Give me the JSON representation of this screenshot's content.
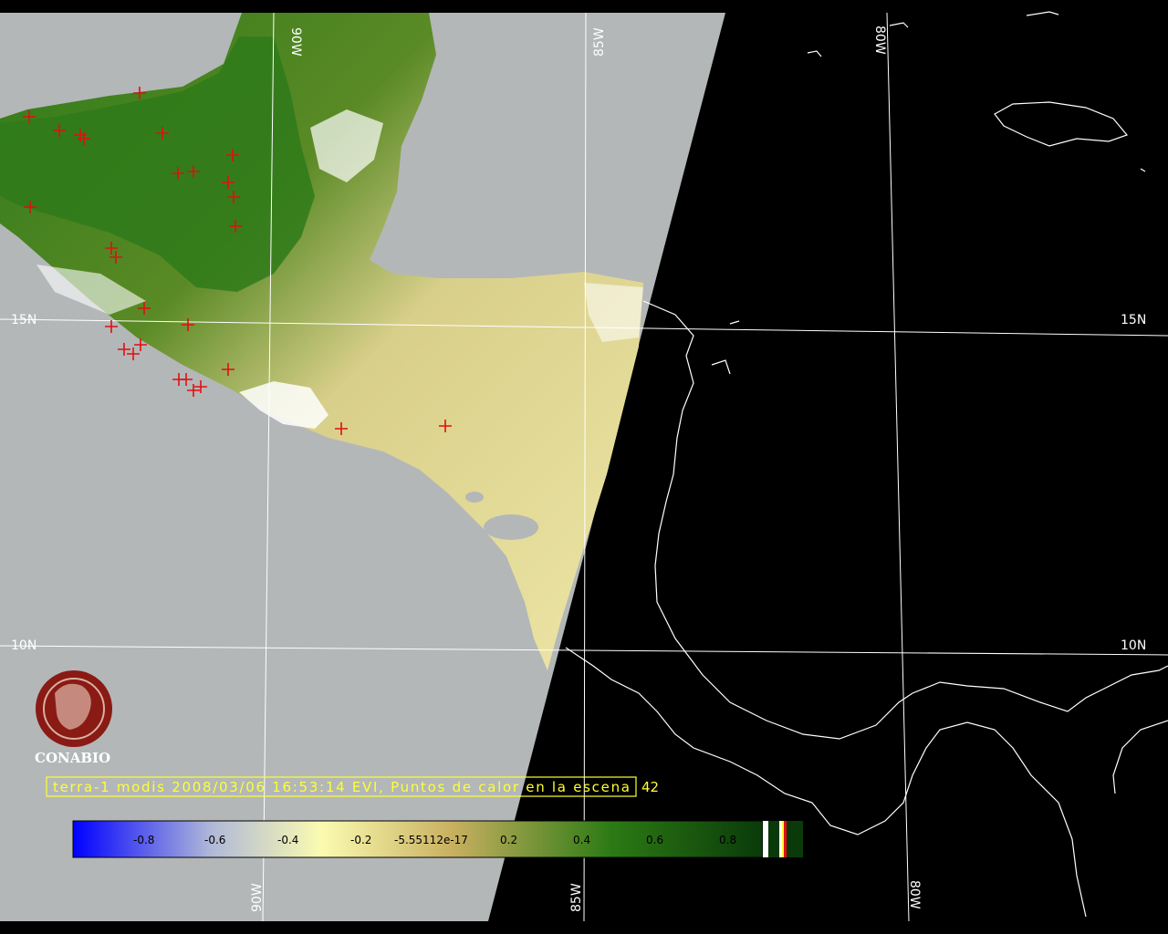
{
  "map": {
    "grid_labels": {
      "lon_90": "90W",
      "lon_85": "85W",
      "lon_80": "80W",
      "lat_15": "15N",
      "lat_10": "10N"
    },
    "caption": {
      "text": "terra-1 modis 2008/03/06 16:53:14 EVI, Puntos de calor en la escena",
      "count": "42"
    },
    "logo": {
      "text": "CONABIO"
    },
    "colorbar": {
      "ticks": [
        "-0.8",
        "-0.6",
        "-0.4",
        "-0.2",
        "-5.55112e-17",
        "0.2",
        "0.4",
        "0.6",
        "0.8"
      ],
      "stops": [
        "#0000ff",
        "#b0b8d8",
        "#fbfbb0",
        "#c8b060",
        "#1a6a12",
        "#0a3a0a"
      ]
    },
    "colors": {
      "outside_swath": "#b3b7b8",
      "land_low": "#e2d992",
      "land_high": "#2f7a1a",
      "hotspot": "#e01010",
      "coastline": "#ffffff",
      "caption": "#ffff33"
    }
  }
}
